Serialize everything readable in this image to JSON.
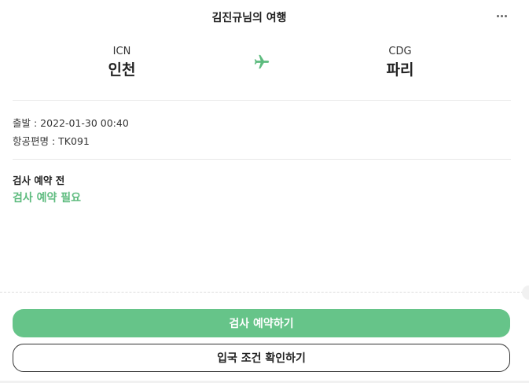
{
  "header": {
    "title": "김진규님의 여행",
    "more_icon": "more-horizontal-icon"
  },
  "route": {
    "from": {
      "code": "ICN",
      "city": "인천"
    },
    "to": {
      "code": "CDG",
      "city": "파리"
    },
    "icon": "airplane-icon",
    "icon_color": "#5dbb7e"
  },
  "info": {
    "departure": "출발 : 2022-01-30 00:40",
    "flight": "항공편명 : TK091"
  },
  "status": {
    "label": "검사 예약 전",
    "value": "검사 예약 필요",
    "color": "#5dbb7e"
  },
  "actions": {
    "primary_label": "검사 예약하기",
    "secondary_label": "입국 조건 확인하기",
    "primary_color": "#66c489"
  }
}
